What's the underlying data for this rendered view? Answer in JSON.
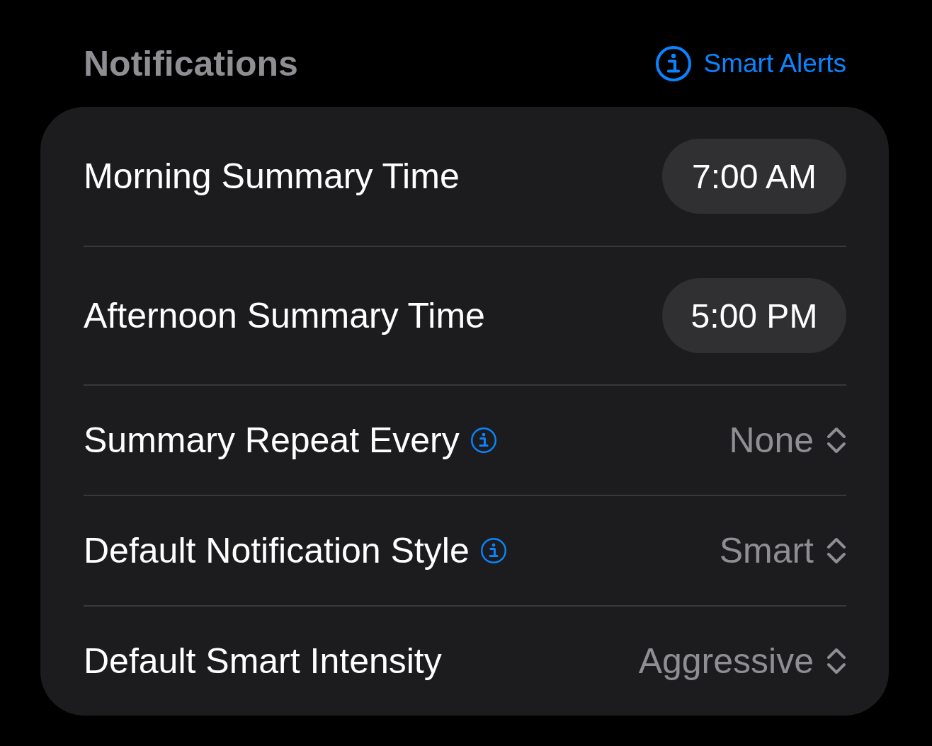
{
  "header": {
    "title": "Notifications",
    "link": {
      "label": "Smart Alerts"
    }
  },
  "settings": [
    {
      "kind": "time",
      "label": "Morning Summary Time",
      "info": false,
      "value": "7:00 AM"
    },
    {
      "kind": "time",
      "label": "Afternoon Summary Time",
      "info": false,
      "value": "5:00 PM"
    },
    {
      "kind": "picker",
      "label": "Summary Repeat Every",
      "info": true,
      "value": "None"
    },
    {
      "kind": "picker",
      "label": "Default Notification Style",
      "info": true,
      "value": "Smart"
    },
    {
      "kind": "picker",
      "label": "Default Smart Intensity",
      "info": false,
      "value": "Aggressive"
    }
  ]
}
